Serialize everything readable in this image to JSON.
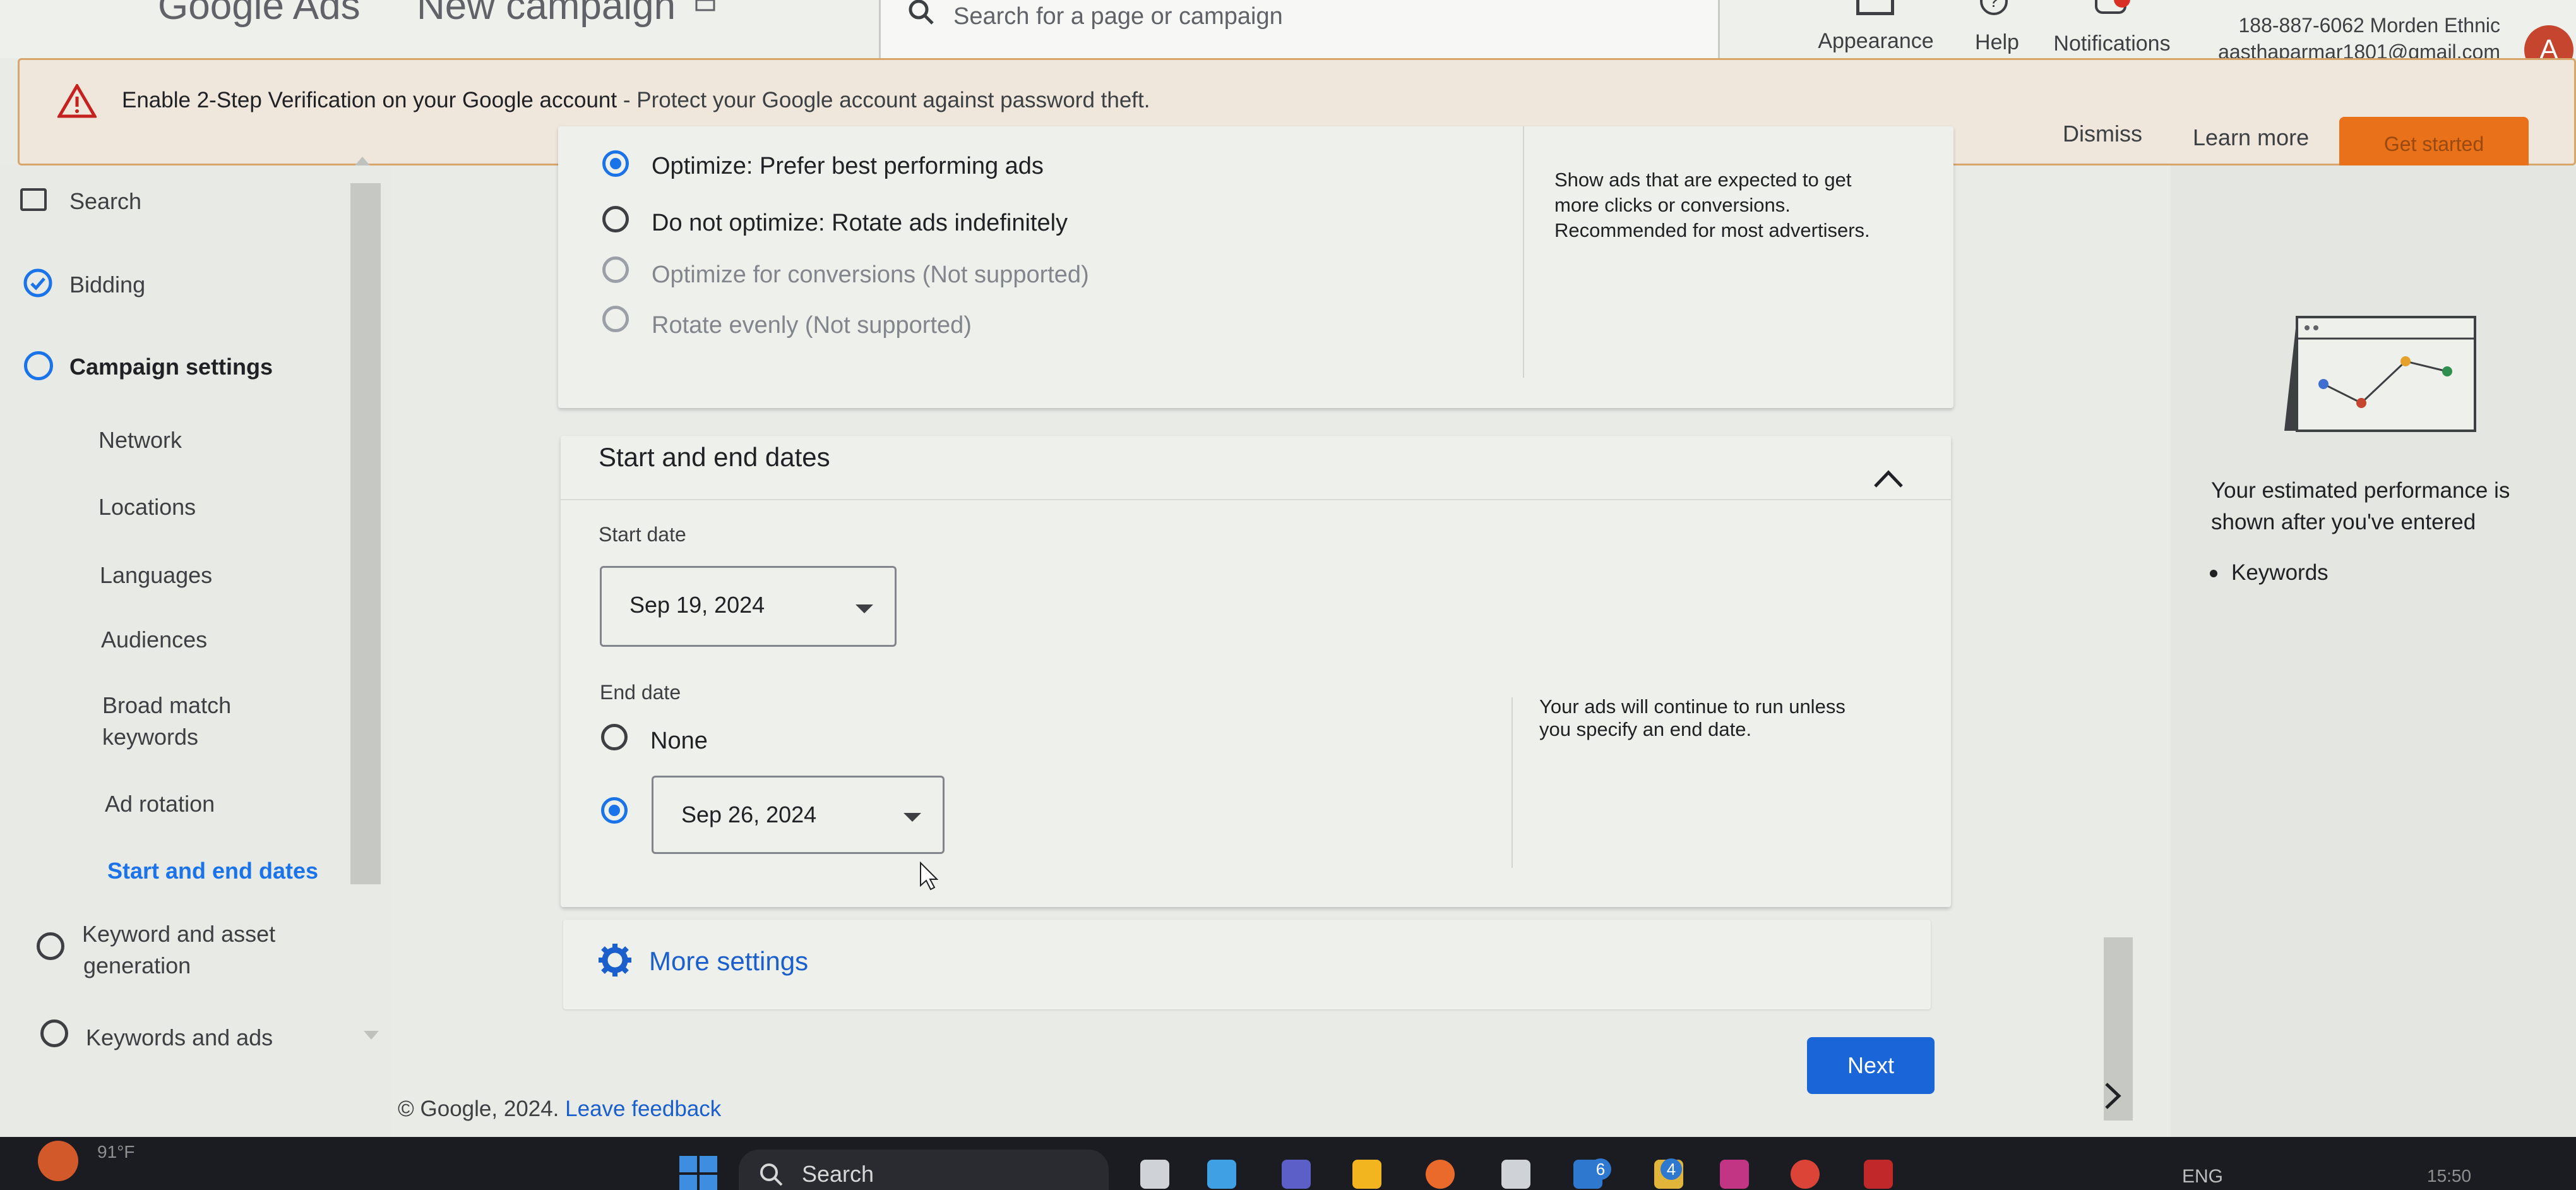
{
  "topbar": {
    "product": "Google Ads",
    "page_title": "New campaign",
    "search_placeholder": "Search for a page or campaign",
    "actions": [
      "Appearance",
      "Help",
      "Notifications"
    ],
    "account_line1": "188-887-6062 Morden Ethnic",
    "account_line2": "aasthaparmar1801@gmail.com",
    "avatar_letter": "A"
  },
  "banner": {
    "bold": "Enable 2-Step Verification on your Google account",
    "rest": " - Protect your Google account against password theft.",
    "dismiss": "Dismiss",
    "learn_more": "Learn more",
    "get_started": "Get started"
  },
  "sidebar": {
    "search": "Search",
    "bidding": "Bidding",
    "campaign_settings": "Campaign settings",
    "sub_items": [
      "Network",
      "Locations",
      "Languages",
      "Audiences",
      "Broad match",
      "keywords",
      "Ad rotation",
      "Start and end dates"
    ],
    "keyword_asset_line1": "Keyword and asset",
    "keyword_asset_line2": "generation",
    "keywords_ads": "Keywords and ads"
  },
  "ad_rotation": {
    "options": [
      "Optimize: Prefer best performing ads",
      "Do not optimize: Rotate ads indefinitely",
      "Optimize for conversions (Not supported)",
      "Rotate evenly (Not supported)"
    ],
    "selected_index": 0,
    "help_line1": "Show ads that are expected to get",
    "help_line2": "more clicks or conversions.",
    "help_line3": "Recommended for most advertisers."
  },
  "dates": {
    "section_title": "Start and end dates",
    "start_label": "Start date",
    "start_value": "Sep 19, 2024",
    "end_label": "End date",
    "none_label": "None",
    "end_value": "Sep 26, 2024",
    "help_line1": "Your ads will continue to run unless",
    "help_line2": "you specify an end date."
  },
  "more_settings": "More settings",
  "next_button": "Next",
  "footer": {
    "copyright": "© Google, 2024.",
    "feedback": "Leave feedback"
  },
  "right_panel": {
    "line1": "Your estimated performance is",
    "line2": "shown after you've entered",
    "bullet": "Keywords"
  },
  "taskbar": {
    "weather": "91°F",
    "search": "Search",
    "lang": "ENG",
    "time": "15:50",
    "badge1": "6",
    "badge2": "4"
  },
  "colors": {
    "accent": "#1a73e8",
    "next_button": "#1a66d9",
    "banner_border": "#d8a56a",
    "get_started": "#e8711a"
  }
}
